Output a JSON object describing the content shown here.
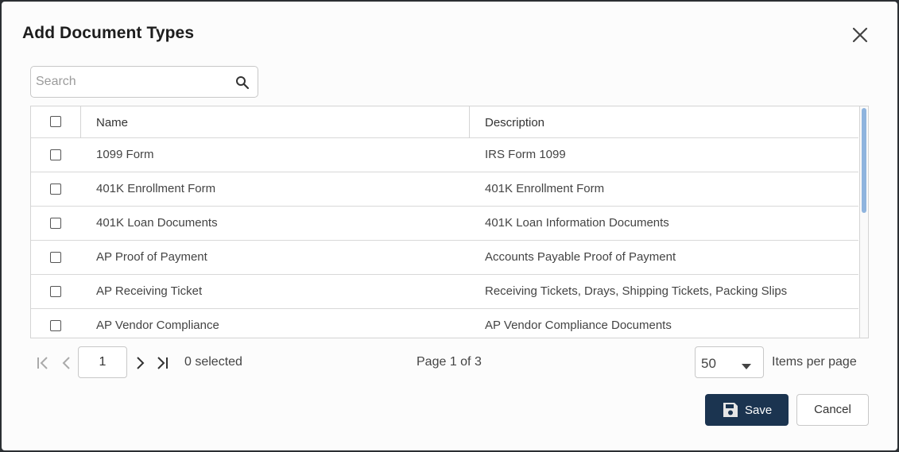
{
  "dialog": {
    "title": "Add Document Types",
    "close_icon": "close-icon"
  },
  "search": {
    "placeholder": "Search",
    "value": "",
    "icon": "search-icon"
  },
  "table": {
    "columns": [
      "Name",
      "Description"
    ],
    "rows": [
      {
        "name": "1099 Form",
        "description": "IRS Form 1099",
        "checked": false
      },
      {
        "name": "401K Enrollment Form",
        "description": "401K Enrollment Form",
        "checked": false
      },
      {
        "name": "401K Loan Documents",
        "description": "401K Loan Information Documents",
        "checked": false
      },
      {
        "name": "AP Proof of Payment",
        "description": "Accounts Payable Proof of Payment",
        "checked": false
      },
      {
        "name": "AP Receiving Ticket",
        "description": "Receiving Tickets, Drays, Shipping Tickets, Packing Slips",
        "checked": false
      },
      {
        "name": "AP Vendor Compliance",
        "description": "AP Vendor Compliance Documents",
        "checked": false
      }
    ]
  },
  "pager": {
    "current_page": "1",
    "selected_text": "0 selected",
    "page_info": "Page 1 of 3",
    "per_page": "50",
    "per_page_label": "Items per page"
  },
  "actions": {
    "save_label": "Save",
    "cancel_label": "Cancel"
  },
  "colors": {
    "primary": "#1b3450",
    "scroll_thumb": "#8fb4de"
  }
}
